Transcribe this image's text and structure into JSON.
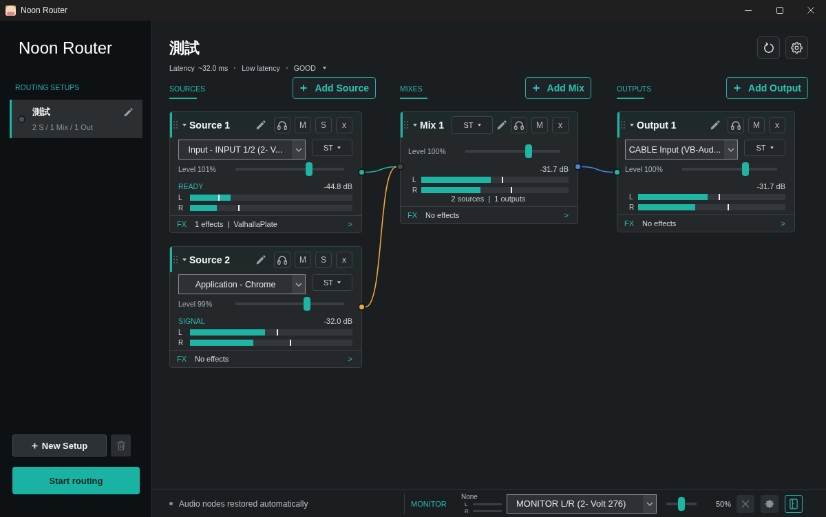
{
  "window": {
    "title": "Noon Router"
  },
  "sidebar": {
    "app_title": "Noon Router",
    "section_label": "ROUTING SETUPS",
    "setups": [
      {
        "name": "測試",
        "summary": "2 S / 1 Mix / 1 Out",
        "selected": true,
        "running": false
      }
    ],
    "new_setup_button": "New Setup",
    "start_button": "Start routing"
  },
  "header": {
    "title": "測試",
    "latency_label": "Latency",
    "latency_value": "~32.0 ms",
    "mode": "Low latency",
    "quality": "GOOD"
  },
  "sources": {
    "title": "SOURCES",
    "add_button": "Add Source",
    "items": [
      {
        "name": "Source 1",
        "buttons": [
          {
            "kind": "monitor"
          },
          {
            "kind": "mute",
            "label": "M"
          },
          {
            "kind": "solo",
            "label": "S"
          },
          {
            "kind": "remove",
            "label": "x"
          }
        ],
        "device": "Input - INPUT 1/2 (2- V...",
        "channel_mode": "ST",
        "level_label": "Level 101%",
        "level": 0.675,
        "status": "READY",
        "reading": "-44.8 dB",
        "meters": [
          {
            "label": "L",
            "level": 0.25,
            "peak": {
              "level": 0.18
            }
          },
          {
            "label": "R",
            "level": 0.165,
            "peak": {
              "level": 0.3
            }
          }
        ],
        "fx_label": "FX",
        "fx": "1 effects  |  ValhallaPlate",
        "expand": ">",
        "color": "#1fb5a5",
        "connected": true
      },
      {
        "name": "Source 2",
        "buttons": [
          {
            "kind": "monitor"
          },
          {
            "kind": "mute",
            "label": "M"
          },
          {
            "kind": "solo",
            "label": "S"
          },
          {
            "kind": "remove",
            "label": "x"
          }
        ],
        "device": "Application - Chrome",
        "channel_mode": "ST",
        "level_label": "Level 99%",
        "level": 0.66,
        "status": "SIGNAL",
        "reading": "-32.0 dB",
        "meters": [
          {
            "label": "L",
            "level": 0.46,
            "peak": {
              "level": 0.54
            }
          },
          {
            "label": "R",
            "level": 0.39,
            "peak": {
              "level": 0.62
            }
          }
        ],
        "fx_label": "FX",
        "fx": "No effects",
        "expand": ">",
        "color": "#f0a93b",
        "connected": true
      }
    ]
  },
  "mixes": {
    "title": "MIXES",
    "add_button": "Add Mix",
    "items": [
      {
        "name": "Mix 1",
        "channel_mode": "ST",
        "buttons": [
          {
            "kind": "monitor"
          },
          {
            "kind": "mute",
            "label": "M"
          },
          {
            "kind": "remove",
            "label": "x"
          }
        ],
        "level_label": "Level 100%",
        "level": 0.665,
        "reading": "-31.7 dB",
        "meters": [
          {
            "label": "L",
            "level": 0.47,
            "peak": {
              "level": 0.55
            }
          },
          {
            "label": "R",
            "level": 0.4,
            "peak": {
              "level": 0.61
            }
          }
        ],
        "summary": "2 sources  |  1 outputs",
        "fx_label": "FX",
        "fx": "No effects",
        "expand": ">",
        "color": "#4b86dc",
        "connected": true
      }
    ]
  },
  "outputs": {
    "title": "OUTPUTS",
    "add_button": "Add Output",
    "items": [
      {
        "name": "Output 1",
        "buttons": [
          {
            "kind": "monitor"
          },
          {
            "kind": "mute",
            "label": "M"
          },
          {
            "kind": "remove",
            "label": "x"
          }
        ],
        "device": "CABLE Input (VB-Aud...",
        "channel_mode": "ST",
        "level_label": "Level 100%",
        "level": 0.665,
        "reading": "-31.7 dB",
        "meters": [
          {
            "label": "L",
            "level": 0.47,
            "peak": {
              "level": 0.55
            }
          },
          {
            "label": "R",
            "level": 0.39,
            "peak": {
              "level": 0.61
            }
          }
        ],
        "fx_label": "FX",
        "fx": "No effects",
        "expand": ">",
        "color": "#1fb5a5"
      }
    ]
  },
  "status_bar": {
    "message": "Audio nodes restored automatically",
    "monitor_label": "MONITOR",
    "monitor_source": "None",
    "channels": [
      {
        "label": "L"
      },
      {
        "label": "R"
      }
    ],
    "device": "MONITOR L/R (2- Volt 276)",
    "volume": {
      "level": 0.5
    },
    "volume_reading": "50%",
    "buttons": [
      {
        "kind": "stop",
        "disabled": true
      },
      {
        "kind": "record",
        "disabled": true
      },
      {
        "kind": "exit",
        "disabled": false
      }
    ]
  }
}
